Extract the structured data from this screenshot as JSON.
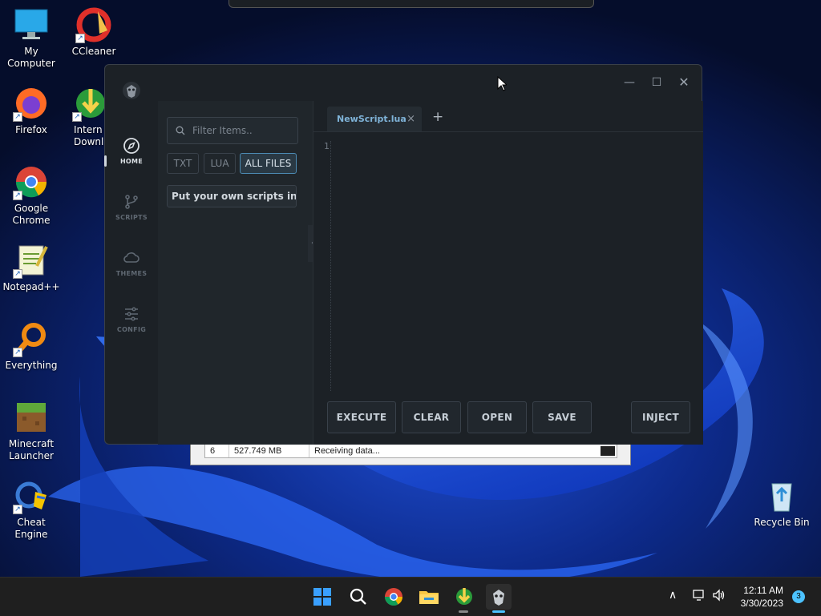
{
  "desktop": {
    "icons": [
      {
        "label": "My Computer"
      },
      {
        "label": "CCleaner"
      },
      {
        "label": "Firefox"
      },
      {
        "label": "Internet Download Manager",
        "visible_label": "Intern\nDownl"
      },
      {
        "label": "Google Chrome"
      },
      {
        "label": "Notepad++"
      },
      {
        "label": "Everything"
      },
      {
        "label": "Minecraft Launcher"
      },
      {
        "label": "Cheat Engine"
      },
      {
        "label": "Recycle Bin"
      }
    ]
  },
  "download_window": {
    "row": {
      "num": "6",
      "size": "527.749  MB",
      "status": "Receiving data..."
    }
  },
  "app": {
    "nav": [
      {
        "label": "HOME",
        "icon": "compass-icon",
        "active": true
      },
      {
        "label": "SCRIPTS",
        "icon": "git-branch-icon",
        "active": false
      },
      {
        "label": "THEMES",
        "icon": "cloud-icon",
        "active": false
      },
      {
        "label": "CONFIG",
        "icon": "sliders-icon",
        "active": false
      }
    ],
    "filter_placeholder": "Filter Items..",
    "file_types": [
      {
        "label": "TXT",
        "active": false
      },
      {
        "label": "LUA",
        "active": false
      },
      {
        "label": "ALL FILES",
        "active": true
      }
    ],
    "file_item": "Put your own scripts in here",
    "tab": {
      "name": "NewScript.lua",
      "close": "×"
    },
    "add_tab": "+",
    "line_number": "1",
    "buttons": {
      "execute": "EXECUTE",
      "clear": "CLEAR",
      "open": "OPEN",
      "save": "SAVE",
      "inject": "INJECT"
    },
    "accent": "#4c8ab3"
  },
  "taskbar": {
    "time": "12:11 AM",
    "date": "3/30/2023",
    "notifications": "3"
  }
}
